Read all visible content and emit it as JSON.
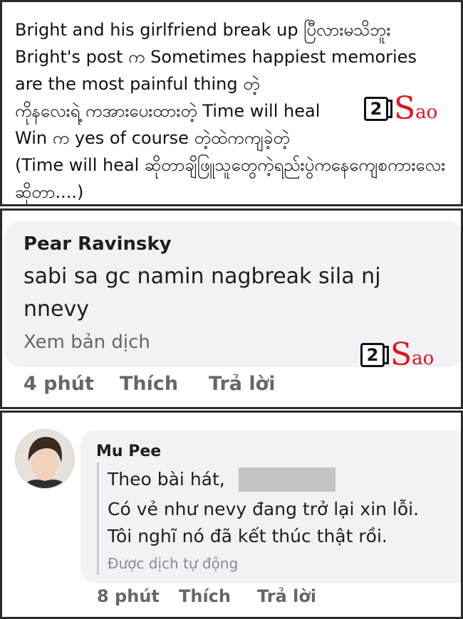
{
  "post": {
    "lines": [
      "Bright and his girlfriend break up ပြီလားမသိဘူး",
      "Bright's post က Sometimes happiest memories",
      "are the most painful thing တဲ့",
      "ကိုနလေးရဲ့ ကအားပေးထားတဲ့ Time will heal",
      "Win က yes of course တဲ့ထဲကကျခဲ့တဲ့",
      "(Time will heal ဆိုတာချိဖြူသူတွေကဲ့ရည်းပွဲကနေကျေစကားလေး",
      "ဆိုတာ....)"
    ]
  },
  "watermark": {
    "box": "2",
    "s": "S",
    "ao": "ao"
  },
  "comment1": {
    "author": "Pear Ravinsky",
    "lines": [
      "sabi sa gc namin nagbreak sila nj",
      "nnevy"
    ],
    "translate": "Xem bản dịch",
    "time": "4 phút",
    "like": "Thích",
    "reply": "Trả lời"
  },
  "comment2": {
    "author": "Mu Pee",
    "lines": [
      "Theo bài hát,",
      "Có vẻ như nevy đang trở lại xin lỗi.",
      "Tôi nghĩ nó đã kết thúc thật rồi."
    ],
    "auto": "Được dịch tự động",
    "time": "8 phút",
    "like": "Thích",
    "reply": "Trả lời"
  },
  "colors": {
    "watermark_red": "#e0141e",
    "bubble": "#f0f2f5",
    "meta": "#65676b"
  }
}
